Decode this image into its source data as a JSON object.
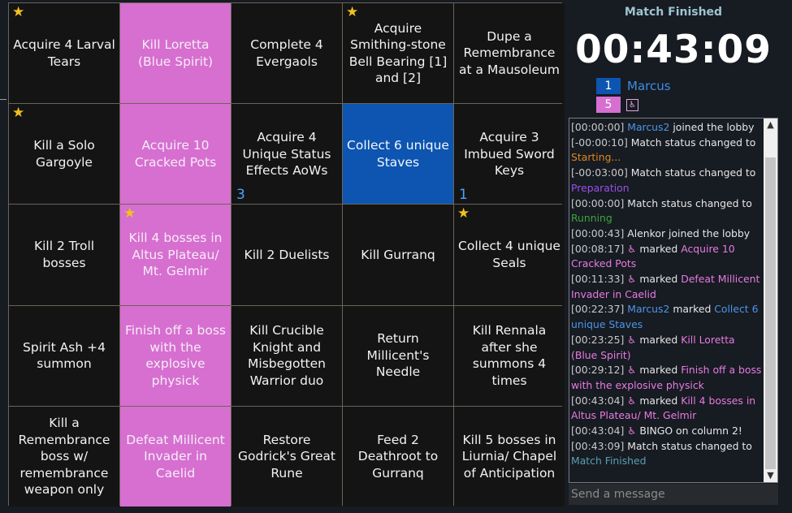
{
  "colors": {
    "board_line": "#6a6458",
    "cell_default": "#141414",
    "team_marcus": "#0d55b0",
    "team_other": "#d66fd0",
    "star": "#f2c21c"
  },
  "board": {
    "cells": [
      {
        "text": "Acquire 4 Larval Tears",
        "owner": "none",
        "star": true,
        "count": ""
      },
      {
        "text": "Kill Loretta (Blue Spirit)",
        "owner": "pink",
        "star": false,
        "count": ""
      },
      {
        "text": "Complete 4 Evergaols",
        "owner": "none",
        "star": false,
        "count": ""
      },
      {
        "text": "Acquire Smithing-stone Bell Bearing [1] and [2]",
        "owner": "none",
        "star": true,
        "count": ""
      },
      {
        "text": "Dupe a Remembrance at a Mausoleum",
        "owner": "none",
        "star": false,
        "count": ""
      },
      {
        "text": "Kill a Solo Gargoyle",
        "owner": "none",
        "star": true,
        "count": ""
      },
      {
        "text": "Acquire 10 Cracked Pots",
        "owner": "pink",
        "star": false,
        "count": ""
      },
      {
        "text": "Acquire 4 Unique Status Effects AoWs",
        "owner": "none",
        "star": false,
        "count": "3"
      },
      {
        "text": "Collect 6 unique Staves",
        "owner": "blue",
        "star": false,
        "count": ""
      },
      {
        "text": "Acquire 3 Imbued Sword Keys",
        "owner": "none",
        "star": false,
        "count": "1"
      },
      {
        "text": "Kill 2 Troll bosses",
        "owner": "none",
        "star": false,
        "count": ""
      },
      {
        "text": "Kill 4 bosses in Altus Plateau/ Mt. Gelmir",
        "owner": "pink",
        "star": true,
        "count": ""
      },
      {
        "text": "Kill 2 Duelists",
        "owner": "none",
        "star": false,
        "count": ""
      },
      {
        "text": "Kill Gurranq",
        "owner": "none",
        "star": false,
        "count": ""
      },
      {
        "text": "Collect 4 unique Seals",
        "owner": "none",
        "star": true,
        "count": ""
      },
      {
        "text": "Spirit Ash +4 summon",
        "owner": "none",
        "star": false,
        "count": ""
      },
      {
        "text": "Finish off a boss with the explosive physick",
        "owner": "pink",
        "star": false,
        "count": ""
      },
      {
        "text": "Kill Crucible Knight and Misbegotten Warrior duo",
        "owner": "none",
        "star": false,
        "count": ""
      },
      {
        "text": "Return Millicent's Needle",
        "owner": "none",
        "star": false,
        "count": ""
      },
      {
        "text": "Kill Rennala after she summons 4 times",
        "owner": "none",
        "star": false,
        "count": ""
      },
      {
        "text": "Kill a Remembrance boss w/ remembrance weapon only",
        "owner": "none",
        "star": false,
        "count": ""
      },
      {
        "text": "Defeat Millicent Invader in Caelid",
        "owner": "pink",
        "star": false,
        "count": ""
      },
      {
        "text": "Restore Godrick's Great Rune",
        "owner": "none",
        "star": false,
        "count": ""
      },
      {
        "text": "Feed 2 Deathroot to Gurranq",
        "owner": "none",
        "star": false,
        "count": ""
      },
      {
        "text": "Kill 5 bosses in Liurnia/ Chapel of Anticipation",
        "owner": "none",
        "star": false,
        "count": ""
      }
    ]
  },
  "match": {
    "status": "Match Finished",
    "timer": "00:43:09"
  },
  "teams": [
    {
      "score": "1",
      "name": "Marcus",
      "color": "#0d55b0",
      "icon": ""
    },
    {
      "score": "5",
      "name": "",
      "color": "#d66fd0",
      "icon": "♿"
    }
  ],
  "chat": {
    "lines": [
      [
        {
          "t": "[00:00:00] ",
          "c": "ts"
        },
        {
          "t": "Marcus2",
          "c": "u-blue"
        },
        {
          "t": " joined the lobby",
          "c": ""
        }
      ],
      [
        {
          "t": "[-00:00:10] ",
          "c": "ts"
        },
        {
          "t": "Match status changed to ",
          "c": ""
        },
        {
          "t": "Starting...",
          "c": "st-orange"
        }
      ],
      [
        {
          "t": "[-00:03:00] ",
          "c": "ts"
        },
        {
          "t": "Match status changed to ",
          "c": ""
        },
        {
          "t": "Preparation",
          "c": "st-purple"
        }
      ],
      [
        {
          "t": "[00:00:00] ",
          "c": "ts"
        },
        {
          "t": "Match status changed to ",
          "c": ""
        },
        {
          "t": "Running",
          "c": "st-green"
        }
      ],
      [
        {
          "t": "[00:00:43] ",
          "c": "ts"
        },
        {
          "t": "Alenkor joined the lobby",
          "c": ""
        }
      ],
      [
        {
          "t": "[00:08:17] ",
          "c": "ts"
        },
        {
          "t": "♿",
          "c": "u-pink"
        },
        {
          "t": " marked ",
          "c": ""
        },
        {
          "t": "Acquire 10 Cracked Pots",
          "c": "u-pink"
        }
      ],
      [
        {
          "t": "[00:11:33] ",
          "c": "ts"
        },
        {
          "t": "♿",
          "c": "u-pink"
        },
        {
          "t": " marked ",
          "c": ""
        },
        {
          "t": "Defeat Millicent Invader in Caelid",
          "c": "u-pink"
        }
      ],
      [
        {
          "t": "[00:22:37] ",
          "c": "ts"
        },
        {
          "t": "Marcus2",
          "c": "u-blue"
        },
        {
          "t": " marked ",
          "c": ""
        },
        {
          "t": "Collect 6 unique Staves",
          "c": "u-blue"
        }
      ],
      [
        {
          "t": "[00:23:25] ",
          "c": "ts"
        },
        {
          "t": "♿",
          "c": "u-pink"
        },
        {
          "t": " marked ",
          "c": ""
        },
        {
          "t": "Kill Loretta (Blue Spirit)",
          "c": "u-pink"
        }
      ],
      [
        {
          "t": "[00:29:12] ",
          "c": "ts"
        },
        {
          "t": "♿",
          "c": "u-pink"
        },
        {
          "t": " marked ",
          "c": ""
        },
        {
          "t": "Finish off a boss with the explosive physick",
          "c": "u-pink"
        }
      ],
      [
        {
          "t": "[00:43:04] ",
          "c": "ts"
        },
        {
          "t": "♿",
          "c": "u-pink"
        },
        {
          "t": " marked ",
          "c": ""
        },
        {
          "t": "Kill 4 bosses in Altus Plateau/ Mt. Gelmir",
          "c": "u-pink"
        }
      ],
      [
        {
          "t": "[00:43:04] ",
          "c": "ts"
        },
        {
          "t": "♿",
          "c": "u-pink"
        },
        {
          "t": " BINGO on column 2!",
          "c": ""
        }
      ],
      [
        {
          "t": "[00:43:09] ",
          "c": "ts"
        },
        {
          "t": "Match status changed to ",
          "c": ""
        },
        {
          "t": "Match Finished",
          "c": "st-teal"
        }
      ]
    ],
    "input_placeholder": "Send a message",
    "input_value": ""
  }
}
